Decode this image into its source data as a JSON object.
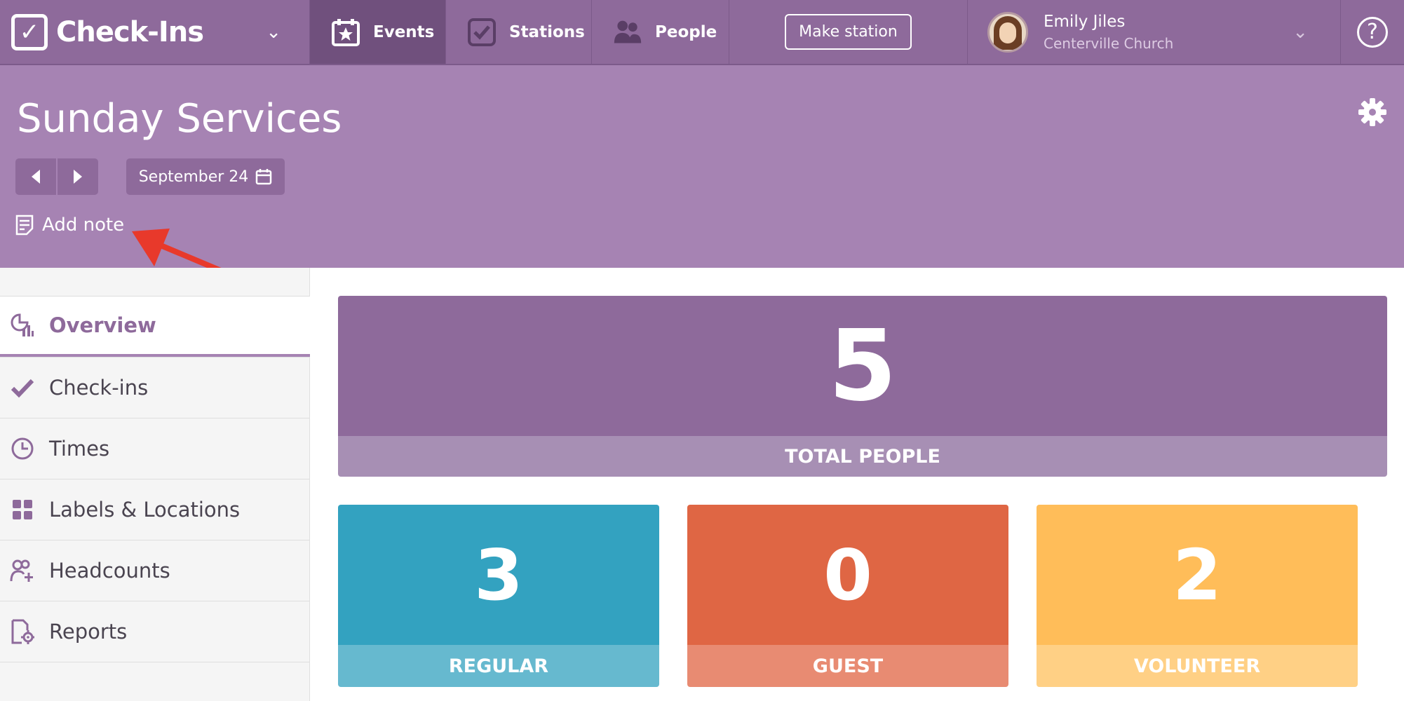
{
  "app": {
    "name": "Check-Ins"
  },
  "nav": {
    "events": "Events",
    "stations": "Stations",
    "people": "People",
    "make_station": "Make station"
  },
  "user": {
    "name": "Emily Jiles",
    "org": "Centerville Church"
  },
  "header": {
    "title": "Sunday Services",
    "date": "September 24",
    "add_note": "Add note"
  },
  "sidebar": {
    "items": [
      {
        "label": "Overview"
      },
      {
        "label": "Check-ins"
      },
      {
        "label": "Times"
      },
      {
        "label": "Labels & Locations"
      },
      {
        "label": "Headcounts"
      },
      {
        "label": "Reports"
      }
    ]
  },
  "stats": {
    "total": {
      "value": "5",
      "label": "TOTAL PEOPLE",
      "color": "#8e6a9b",
      "label_color": "#a78fb4"
    },
    "regular": {
      "value": "3",
      "label": "REGULAR",
      "color": "#33a2c0",
      "label_color": "#66b9cf"
    },
    "guest": {
      "value": "0",
      "label": "GUEST",
      "color": "#df6644",
      "label_color": "#e88b72"
    },
    "volunteer": {
      "value": "2",
      "label": "VOLUNTEER",
      "color": "#ffbd59",
      "label_color": "#ffd085"
    }
  },
  "colors": {
    "brand": "#8e6a9b",
    "header": "#a683b3",
    "annotation": "#e8392b"
  }
}
